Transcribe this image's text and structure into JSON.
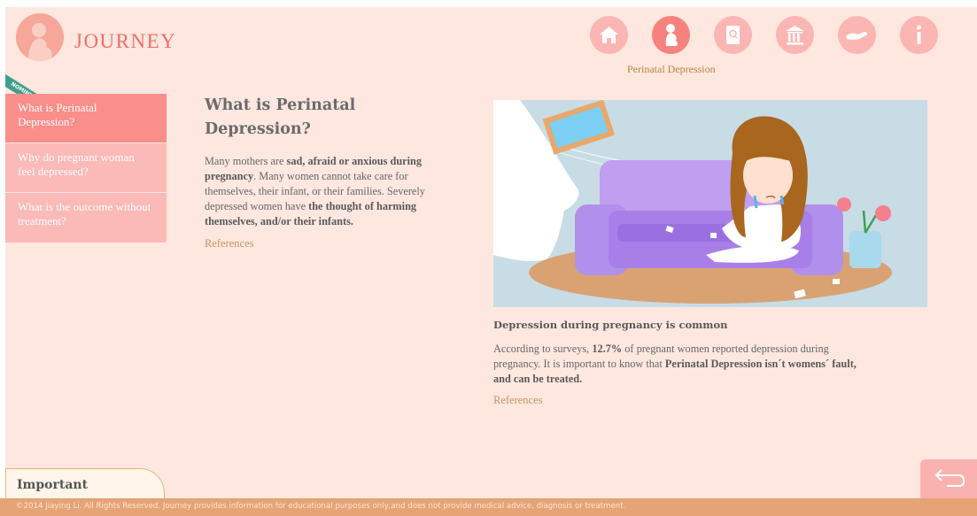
{
  "brand": {
    "name": "JOURNEY",
    "ribbon": "NOMINEE"
  },
  "topnav": {
    "items": [
      {
        "icon": "home-icon"
      },
      {
        "icon": "pregnant-woman-icon",
        "active": true
      },
      {
        "icon": "search-book-icon"
      },
      {
        "icon": "institution-icon"
      },
      {
        "icon": "helping-hand-icon"
      },
      {
        "icon": "info-icon"
      }
    ],
    "active_label": "Perinatal Depression"
  },
  "sidebar": {
    "items": [
      {
        "label": "What is Perinatal Depression?",
        "active": true
      },
      {
        "label": "Why do pregnant woman feel depressed?"
      },
      {
        "label": "What is the outcome without treatment?"
      }
    ]
  },
  "left": {
    "title": "What is Perinatal Depression?",
    "body": {
      "p1": "Many mothers are ",
      "b1": "sad, afraid or anxious during pregnancy",
      "p2": ". Many women cannot take care for themselves, their infant, or their families. Severely depressed women have ",
      "b2": "the thought of harming themselves, and/or their infants."
    },
    "references": "References"
  },
  "right": {
    "caption_title": "Depression during pregnancy is common",
    "body": {
      "p1": "According to surveys, ",
      "b1": "12.7%",
      "p2": " of pregnant women reported depression during pregnancy. It is important to know that ",
      "b2": "Perinatal Depression isn´t womens´ fault, and can be treated."
    },
    "references": "References"
  },
  "important": {
    "label": "Important"
  },
  "footer": {
    "text": "©2014 Jiaying Li. All Rights Reserved. Journey provides information for educational purposes only,and does not provide medical advice, diagnosis or treatment."
  },
  "colors": {
    "panel_bg": "#fde7df",
    "accent": "#f06e69",
    "nav_active": "#fa8e8b",
    "nav": "#fbb9b7",
    "footer": "#e6a376",
    "link": "#c6955d"
  }
}
